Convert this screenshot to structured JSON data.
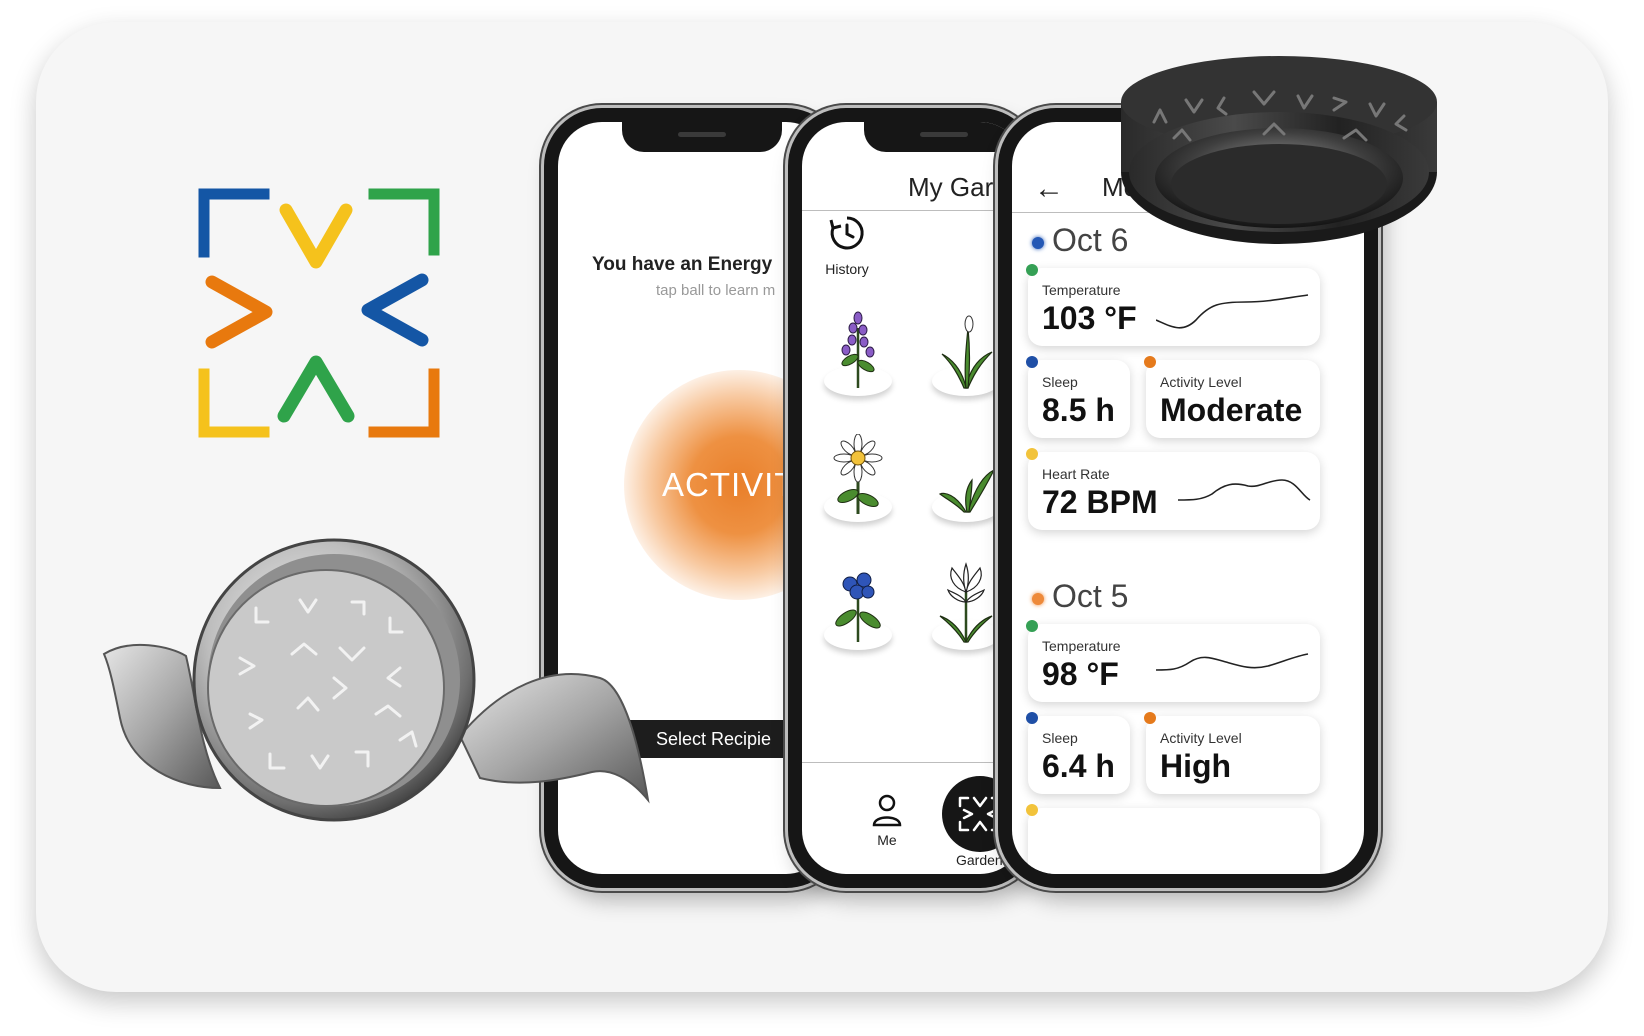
{
  "brand": {
    "logo_colors": {
      "blue": "#1456a5",
      "yellow": "#f5c21c",
      "green": "#2fa34a",
      "orange": "#e8790e"
    }
  },
  "phone_energy": {
    "title": "You have an Energy",
    "subtitle": "tap ball to learn m",
    "ball_label": "ACTIVIT",
    "select_button": "Select Recipie"
  },
  "phone_garden": {
    "title": "My Gard",
    "history_label": "History",
    "plants": [
      "lavender-icon",
      "snowdrop-icon",
      "daisy-icon",
      "sprout-icon",
      "bluebell-icon",
      "lily-icon"
    ],
    "nav": {
      "me_label": "Me",
      "garden_label": "Garden"
    }
  },
  "phone_metrics": {
    "title": "Mei’s",
    "days": [
      {
        "date": "Oct 6",
        "date_color": "#2458b5",
        "temperature": {
          "label": "Temperature",
          "value": "103 °F"
        },
        "sleep": {
          "label": "Sleep",
          "value": "8.5 h"
        },
        "activity": {
          "label": "Activity Level",
          "value": "Moderate"
        },
        "heart_rate": {
          "label": "Heart Rate",
          "value": "72 BPM"
        }
      },
      {
        "date": "Oct 5",
        "date_color": "#ee8a3a",
        "temperature": {
          "label": "Temperature",
          "value": "98 °F"
        },
        "sleep": {
          "label": "Sleep",
          "value": "6.4 h"
        },
        "activity": {
          "label": "Activity Level",
          "value": "High"
        }
      }
    ],
    "dot_colors": {
      "temperature": "#35a055",
      "sleep": "#1f4fa6",
      "activity": "#e57a1c",
      "heart_rate": "#f2c33b"
    }
  }
}
